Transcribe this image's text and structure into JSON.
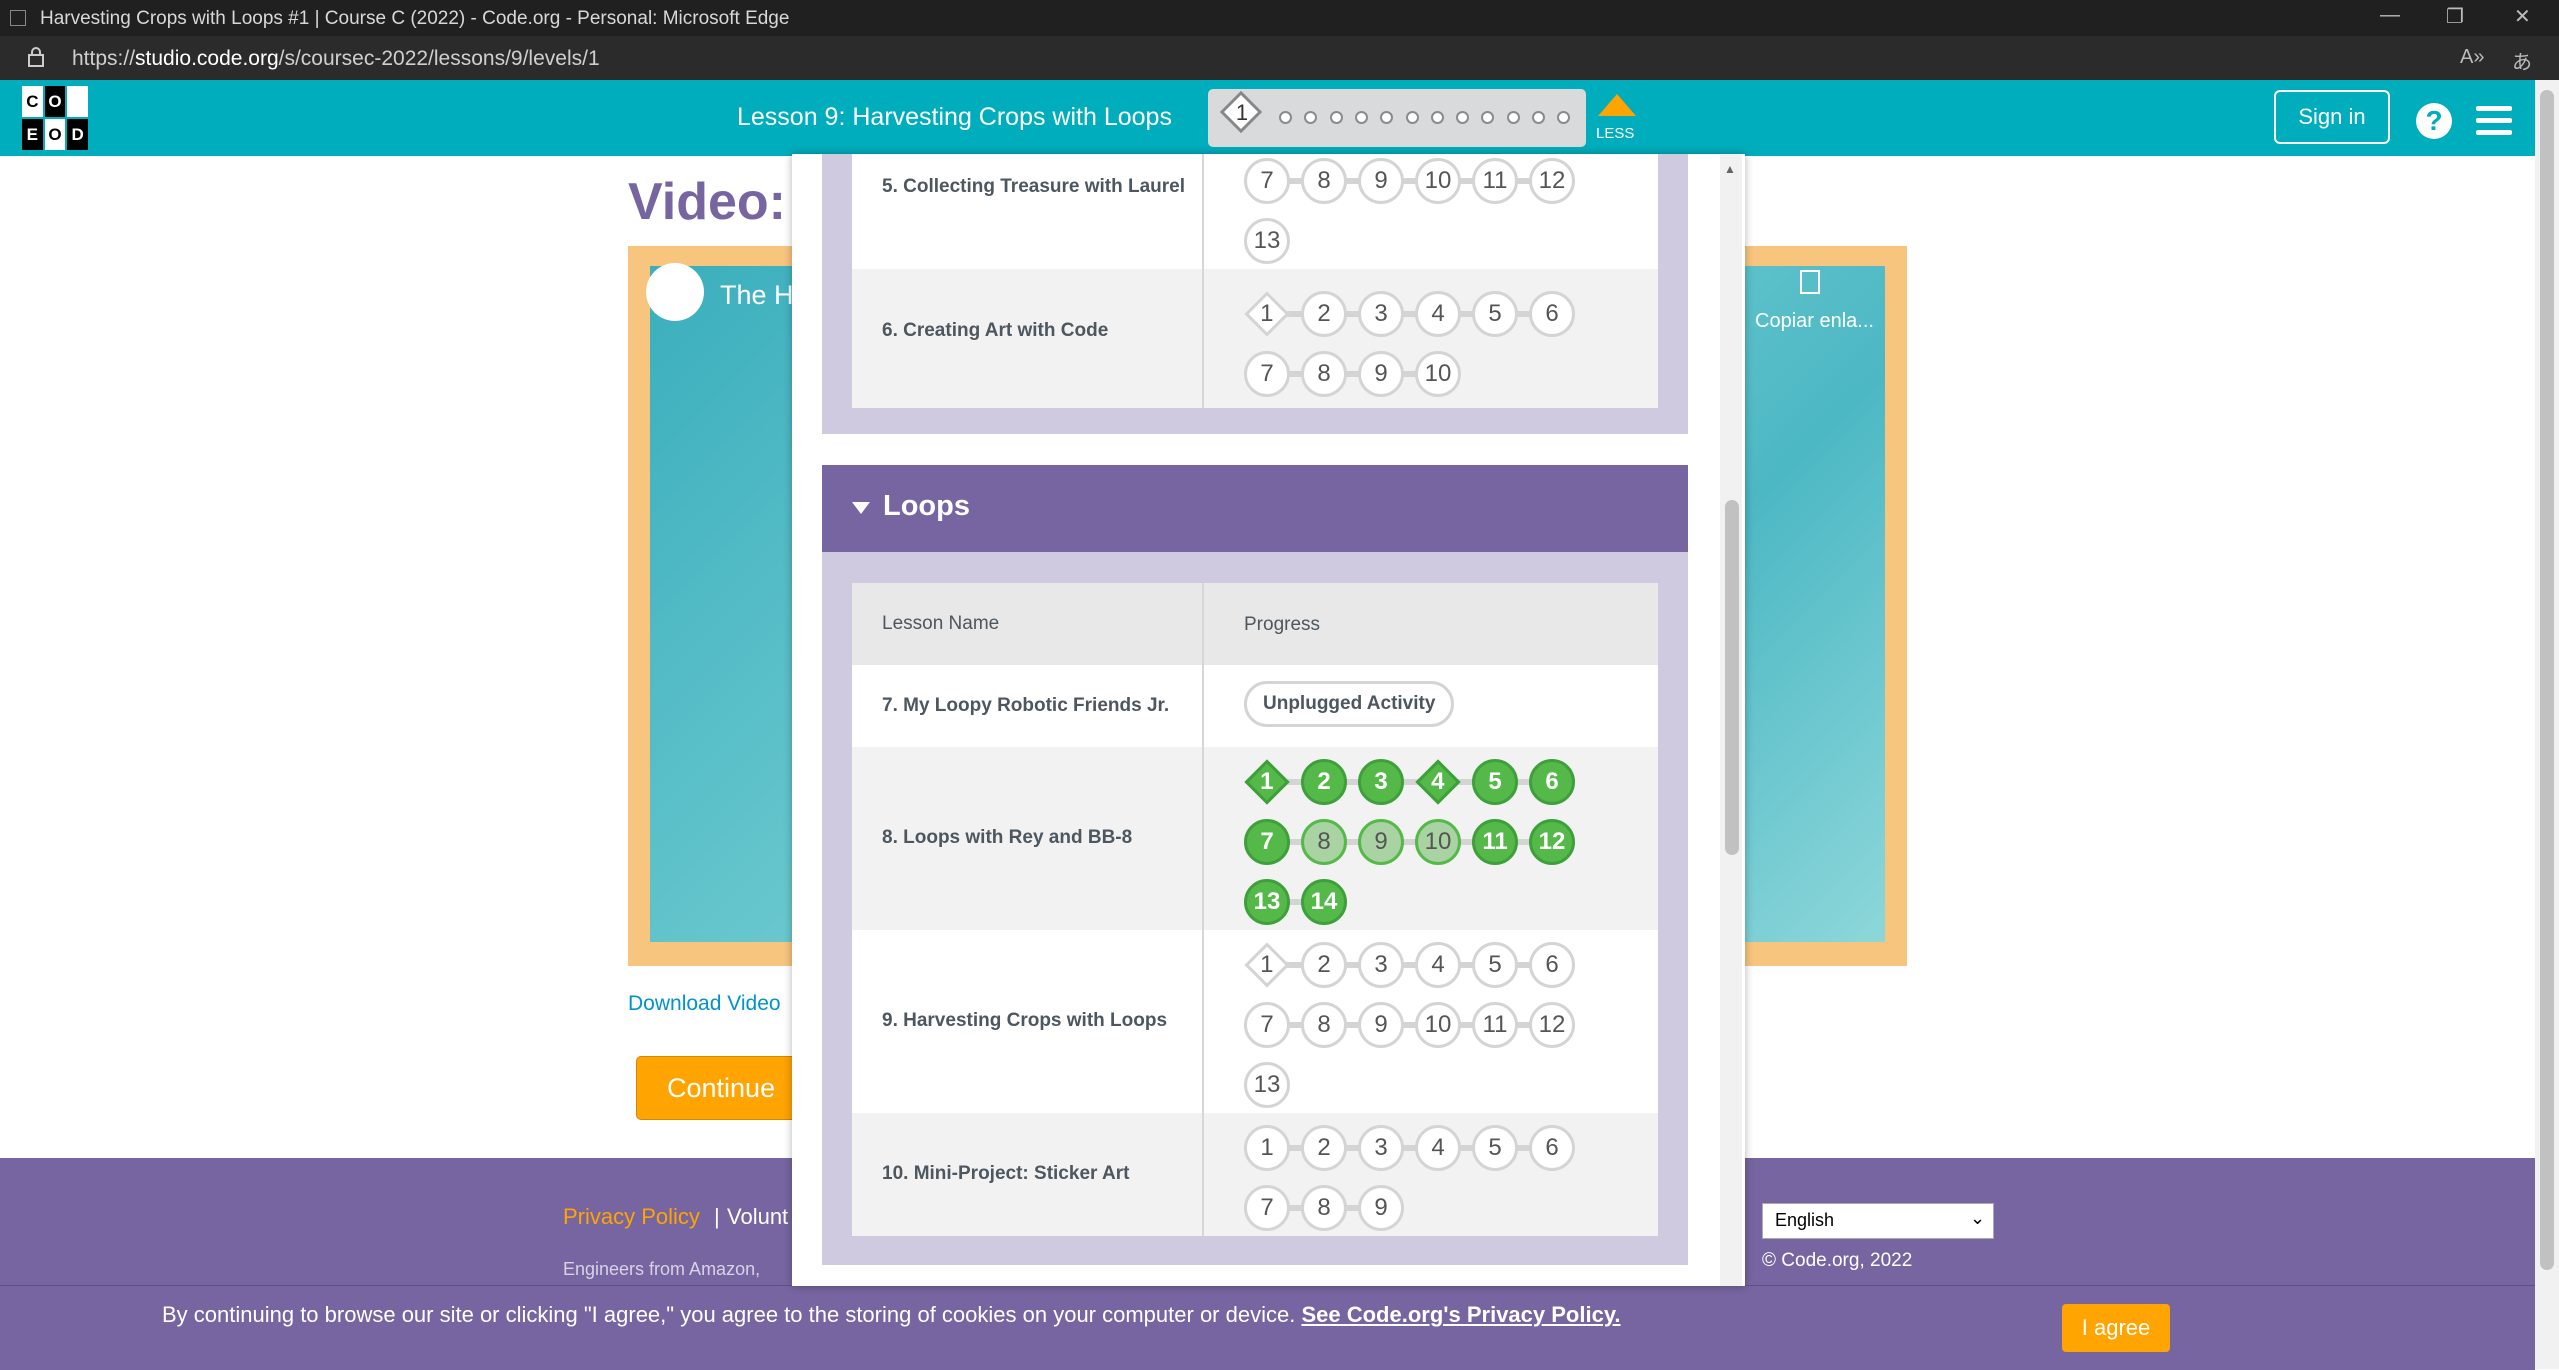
{
  "browser": {
    "window_title": "Harvesting Crops with Loops #1 | Course C (2022) - Code.org - Personal: Microsoft Edge",
    "url_prefix": "https://",
    "url_host": "studio.code.org",
    "url_path": "/s/coursec-2022/lessons/9/levels/1"
  },
  "header": {
    "logo_letters": [
      "C",
      "O",
      "D",
      "E"
    ],
    "lesson_title": "Lesson 9: Harvesting Crops with Loops",
    "current_level": "1",
    "remaining_levels": 12,
    "less_label": "LESS",
    "sign_in": "Sign in",
    "help": "?"
  },
  "page": {
    "video_heading": "Video:",
    "video_title": "The H",
    "copy_link": "Copiar enla...",
    "download": "Download Video",
    "continue": "Continue"
  },
  "footer": {
    "privacy": "Privacy Policy",
    "separator": "|",
    "volunteer": "Volunt",
    "engineers": "Engineers from Amazon,",
    "language": "English",
    "copyright": "© Code.org, 2022"
  },
  "cookie": {
    "text": "By continuing to browse our site or clicking \"I agree,\" you agree to the storing of cookies on your computer or device.",
    "link": "See Code.org's Privacy Policy.",
    "agree": "I agree"
  },
  "modal": {
    "prev_unit_rows": [
      {
        "name": "5. Collecting Treasure with Laurel",
        "levels": [
          "7",
          "8",
          "9",
          "10",
          "11",
          "12",
          "13"
        ]
      },
      {
        "name": "6. Creating Art with Code",
        "levels": [
          "1",
          "2",
          "3",
          "4",
          "5",
          "6",
          "7",
          "8",
          "9",
          "10"
        ]
      }
    ],
    "loops_unit": {
      "title": "Loops",
      "col_lesson": "Lesson Name",
      "col_progress": "Progress",
      "rows": [
        {
          "name": "7. My Loopy Robotic Friends Jr.",
          "pill": "Unplugged Activity"
        },
        {
          "name": "8. Loops with Rey and BB-8",
          "levels": [
            "1",
            "2",
            "3",
            "4",
            "5",
            "6",
            "7",
            "8",
            "9",
            "10",
            "11",
            "12",
            "13",
            "14"
          ]
        },
        {
          "name": "9. Harvesting Crops with Loops",
          "levels": [
            "1",
            "2",
            "3",
            "4",
            "5",
            "6",
            "7",
            "8",
            "9",
            "10",
            "11",
            "12",
            "13"
          ]
        },
        {
          "name": "10. Mini-Project: Sticker Art",
          "levels": [
            "1",
            "2",
            "3",
            "4",
            "5",
            "6",
            "7",
            "8",
            "9"
          ]
        }
      ]
    }
  },
  "colors": {
    "teal": "#00adbc",
    "purple": "#7665a0",
    "orange": "#ffa400",
    "green": "#54b948"
  }
}
